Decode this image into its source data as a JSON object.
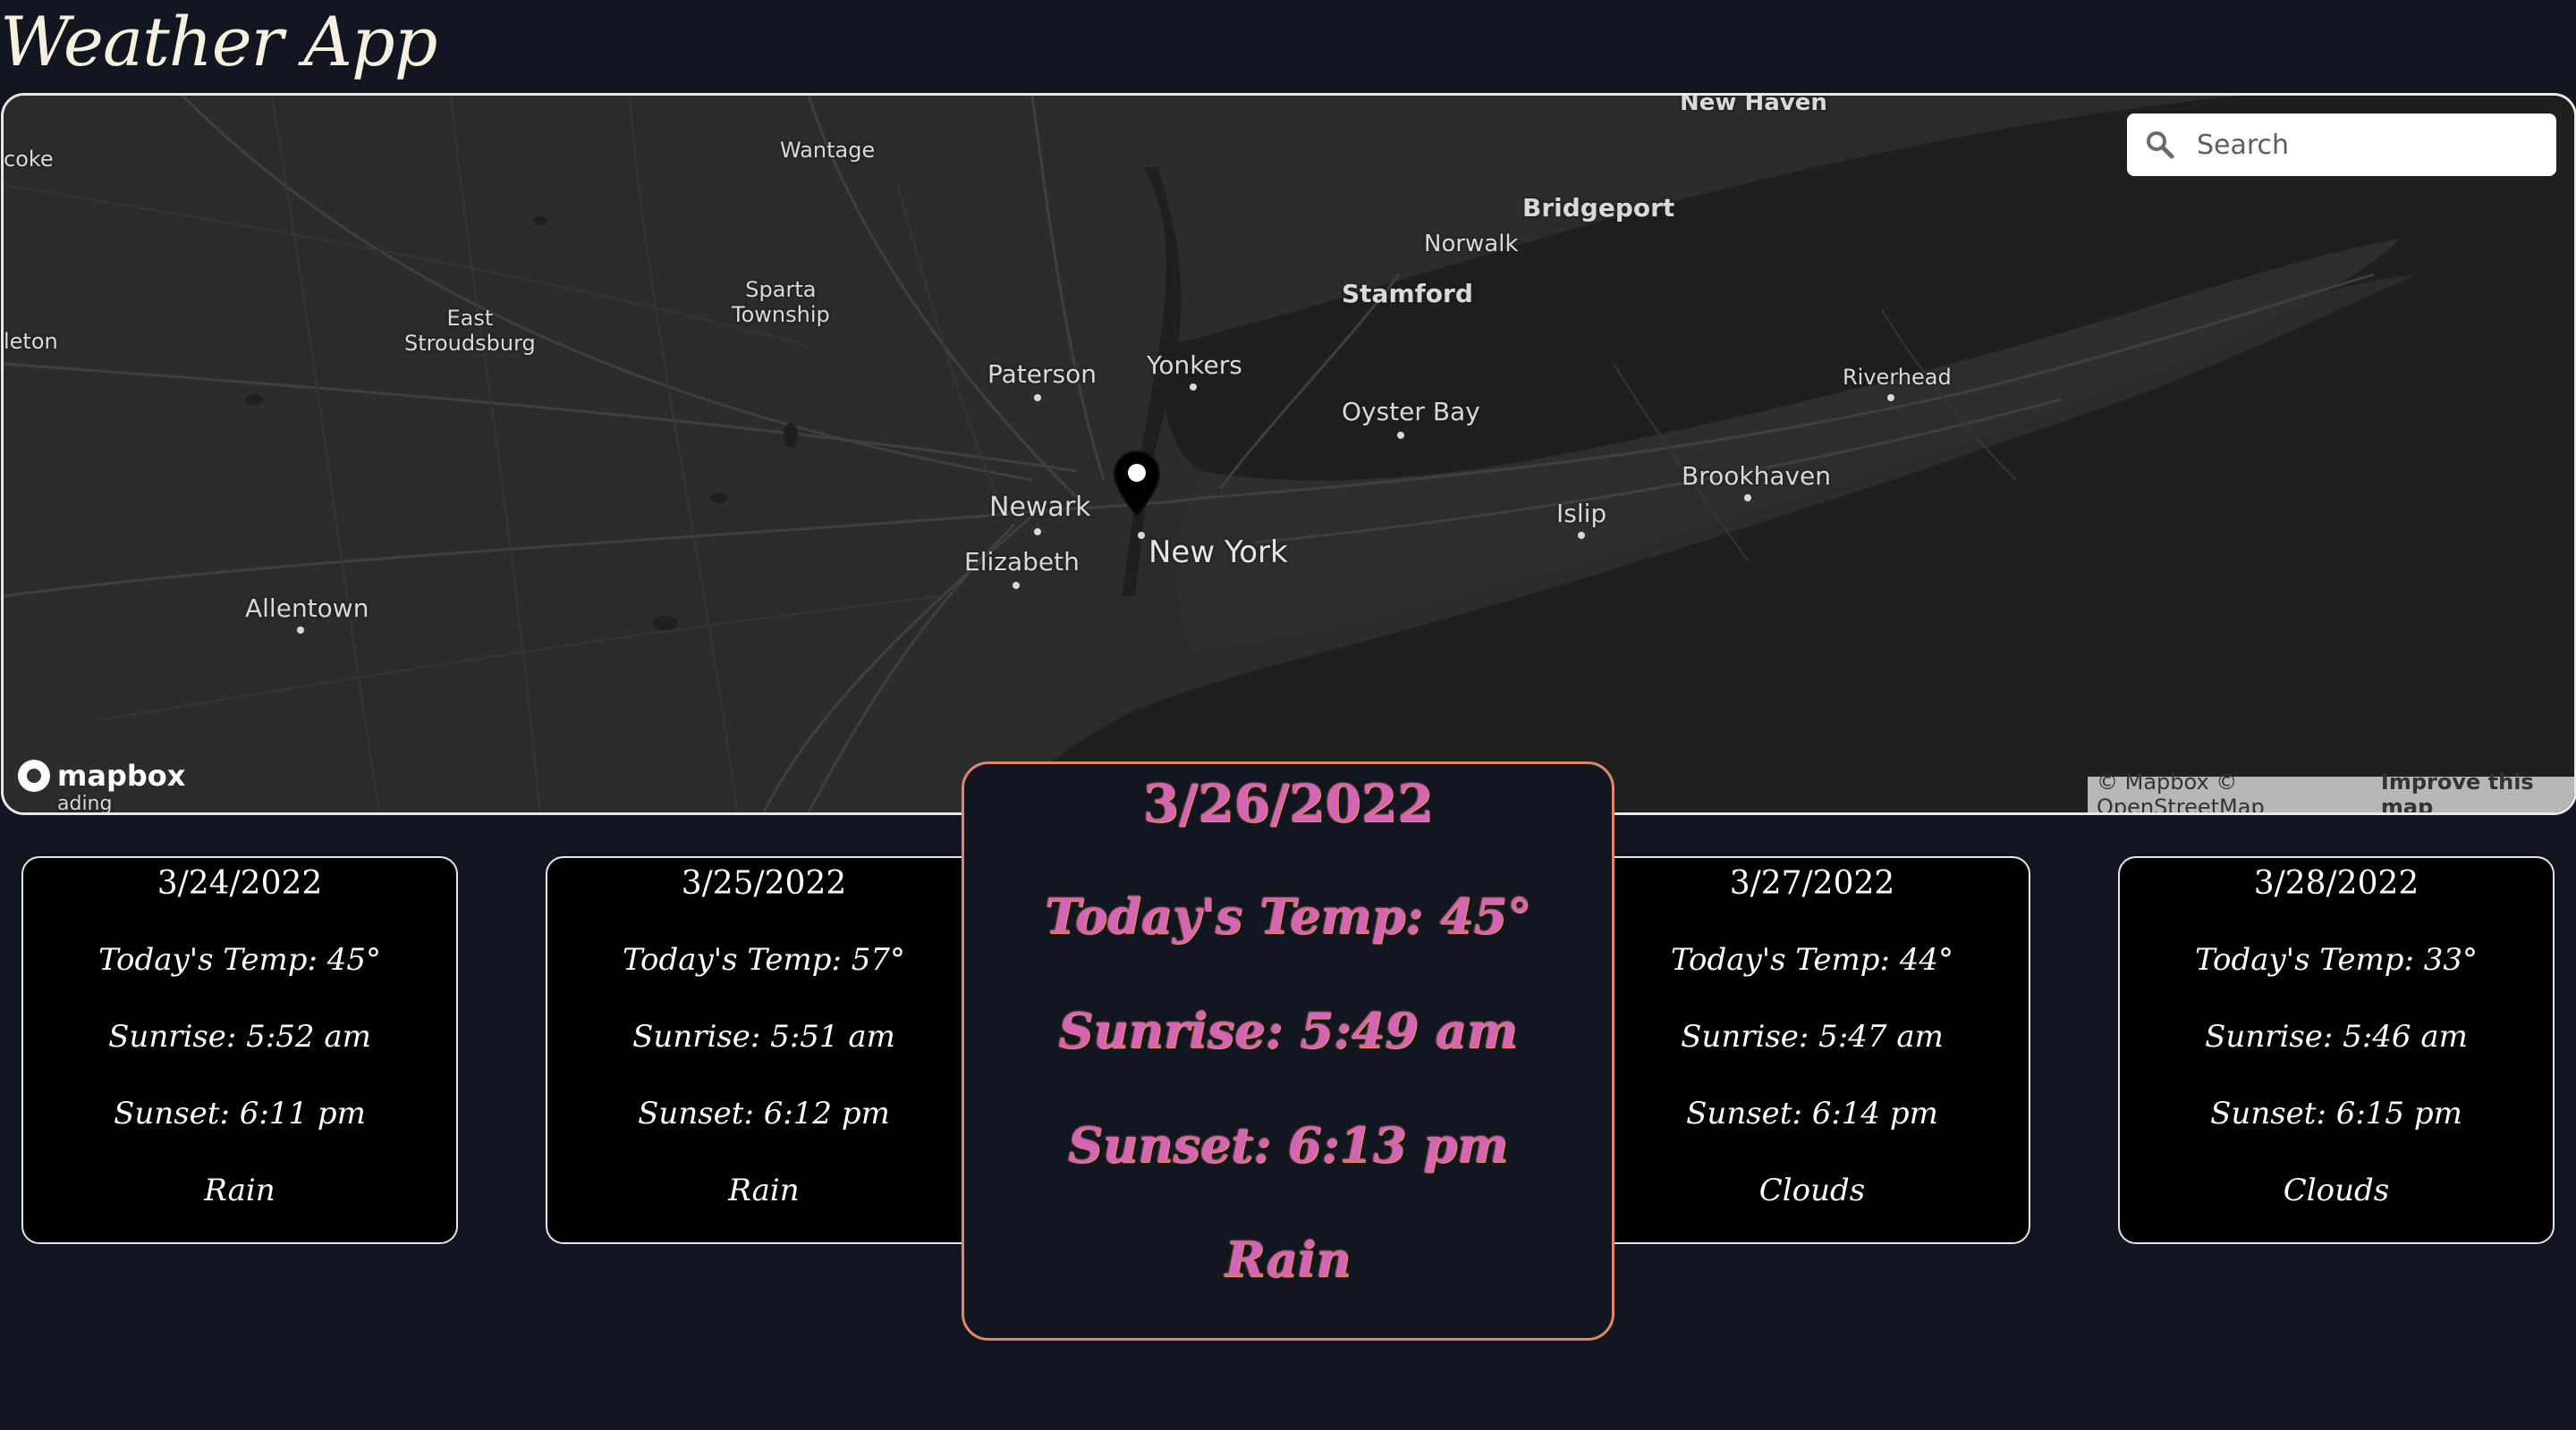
{
  "header": {
    "title": "Weather App"
  },
  "map": {
    "search": {
      "placeholder": "Search"
    },
    "logo": "mapbox",
    "attribution": {
      "text": "© Mapbox © OpenStreetMap",
      "improve": "Improve this map"
    },
    "labels": {
      "new_haven": "New Haven",
      "coke": "coke",
      "wantage": "Wantage",
      "bridgeport": "Bridgeport",
      "norwalk": "Norwalk",
      "stamford": "Stamford",
      "leton": "leton",
      "east_stroudsburg": "East\nStroudsburg",
      "sparta": "Sparta\nTownship",
      "paterson": "Paterson",
      "yonkers": "Yonkers",
      "riverhead": "Riverhead",
      "oyster_bay": "Oyster Bay",
      "brookhaven": "Brookhaven",
      "newark": "Newark",
      "islip": "Islip",
      "new_york": "New York",
      "elizabeth": "Elizabeth",
      "allentown": "Allentown",
      "reading": "ading"
    },
    "marker_icon": "map-pin-icon"
  },
  "forecast": [
    {
      "date": "3/24/2022",
      "temp": "Today's Temp: 45°",
      "sunrise": "Sunrise: 5:52 am",
      "sunset": "Sunset: 6:11 pm",
      "condition": "Rain"
    },
    {
      "date": "3/25/2022",
      "temp": "Today's Temp: 57°",
      "sunrise": "Sunrise: 5:51 am",
      "sunset": "Sunset: 6:12 pm",
      "condition": "Rain"
    },
    {
      "date": "3/26/2022",
      "temp": "Today's Temp: 45°",
      "sunrise": "Sunrise: 5:49 am",
      "sunset": "Sunset: 6:13 pm",
      "condition": "Rain"
    },
    {
      "date": "3/27/2022",
      "temp": "Today's Temp: 44°",
      "sunrise": "Sunrise: 5:47 am",
      "sunset": "Sunset: 6:14 pm",
      "condition": "Clouds"
    },
    {
      "date": "3/28/2022",
      "temp": "Today's Temp: 33°",
      "sunrise": "Sunrise: 5:46 am",
      "sunset": "Sunset: 6:15 pm",
      "condition": "Clouds"
    }
  ],
  "colors": {
    "background": "#121620",
    "card_bg": "#000000",
    "featured_text": "#d464b4",
    "featured_border": "#e0876a",
    "title": "#f6f1df"
  }
}
